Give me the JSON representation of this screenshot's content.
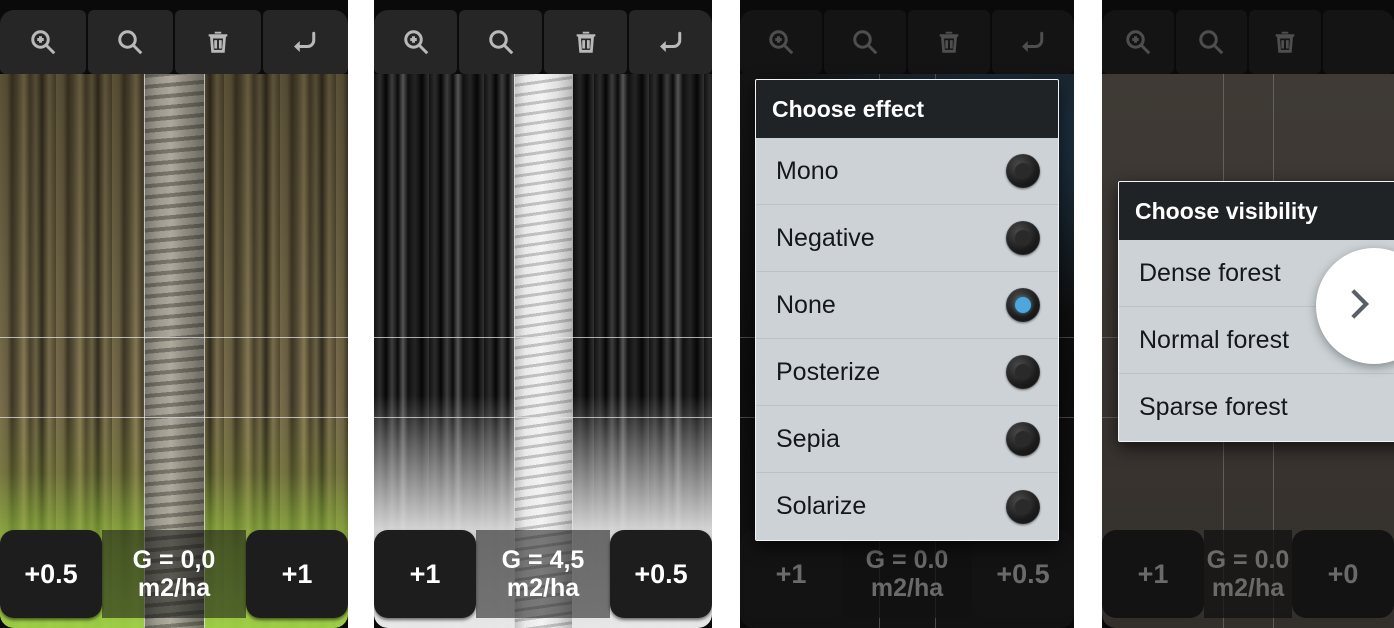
{
  "app": {
    "name": "forest-relascope-app",
    "accent_blue": "#4fa6da",
    "dialog_bg": "#ccd2d6",
    "dialog_header_bg": "#1f2326",
    "toolbar_bg": "#262626"
  },
  "toolbar": {
    "buttons": [
      {
        "icon": "zoom-in-icon",
        "label": "Zoom in"
      },
      {
        "icon": "search-icon",
        "label": "Search"
      },
      {
        "icon": "trash-icon",
        "label": "Delete"
      },
      {
        "icon": "undo-icon",
        "label": "Undo"
      }
    ]
  },
  "panels": [
    {
      "id": "panel-color-photo",
      "effect": "None",
      "bottom": {
        "left_button": "+0.5",
        "readout": "G = 0,0",
        "readout_unit": "m2/ha",
        "right_button": "+1"
      }
    },
    {
      "id": "panel-mono-photo",
      "effect": "Mono",
      "bottom": {
        "left_button": "+1",
        "readout": "G = 4,5",
        "readout_unit": "m2/ha",
        "right_button": "+0.5"
      }
    },
    {
      "id": "panel-choose-effect",
      "bottom": {
        "left_button": "+1",
        "readout": "G = 0.0",
        "readout_unit": "m2/ha",
        "right_button": "+0.5"
      },
      "dialog": {
        "title": "Choose effect",
        "options": [
          {
            "label": "Mono",
            "selected": false
          },
          {
            "label": "Negative",
            "selected": false
          },
          {
            "label": "None",
            "selected": true
          },
          {
            "label": "Posterize",
            "selected": false
          },
          {
            "label": "Sepia",
            "selected": false
          },
          {
            "label": "Solarize",
            "selected": false
          }
        ]
      }
    },
    {
      "id": "panel-choose-visibility",
      "bottom": {
        "left_button": "+1",
        "readout": "G = 0.0",
        "readout_unit": "m2/ha",
        "right_button": "+0"
      },
      "dialog": {
        "title": "Choose visibility",
        "options": [
          {
            "label": "Dense forest"
          },
          {
            "label": "Normal forest"
          },
          {
            "label": "Sparse forest"
          }
        ]
      },
      "fab": {
        "icon": "chevron-right-icon",
        "label": "Next"
      }
    }
  ]
}
